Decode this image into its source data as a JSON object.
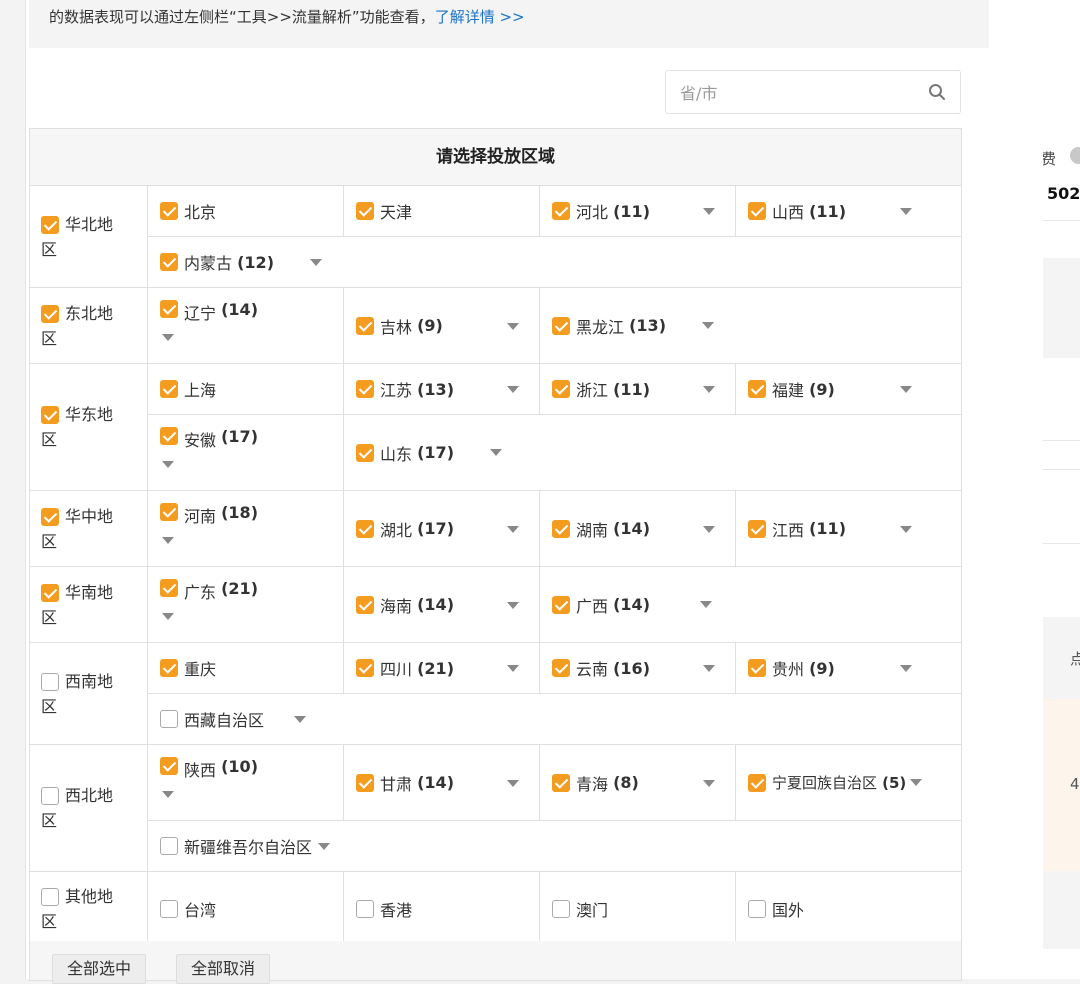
{
  "notice": {
    "text": "的数据表现可以通过左侧栏“工具>>流量解析”功能查看，",
    "link": "了解详情 >>"
  },
  "search": {
    "placeholder": "省/市",
    "value": ""
  },
  "table_title": "请选择投放区域",
  "regions": {
    "north": {
      "label": "华北地区",
      "checked": true
    },
    "northeast": {
      "label": "东北地区",
      "checked": true
    },
    "east": {
      "label": "华东地区",
      "checked": true
    },
    "central": {
      "label": "华中地区",
      "checked": true
    },
    "south": {
      "label": "华南地区",
      "checked": true
    },
    "southwest": {
      "label": "西南地区",
      "checked": false
    },
    "northwest": {
      "label": "西北地区",
      "checked": false
    },
    "other": {
      "label": "其他地区",
      "checked": false
    }
  },
  "provinces": {
    "beijing": {
      "name": "北京",
      "count": ""
    },
    "tianjin": {
      "name": "天津",
      "count": ""
    },
    "hebei": {
      "name": "河北",
      "count": "(11)"
    },
    "shanxi": {
      "name": "山西",
      "count": "(11)"
    },
    "neimenggu": {
      "name": "内蒙古",
      "count": "(12)"
    },
    "liaoning": {
      "name": "辽宁",
      "count": "(14)"
    },
    "jilin": {
      "name": "吉林",
      "count": "(9)"
    },
    "heilongjiang": {
      "name": "黑龙江",
      "count": "(13)"
    },
    "shanghai": {
      "name": "上海",
      "count": ""
    },
    "jiangsu": {
      "name": "江苏",
      "count": "(13)"
    },
    "zhejiang": {
      "name": "浙江",
      "count": "(11)"
    },
    "fujian": {
      "name": "福建",
      "count": "(9)"
    },
    "anhui": {
      "name": "安徽",
      "count": "(17)"
    },
    "shandong": {
      "name": "山东",
      "count": "(17)"
    },
    "henan": {
      "name": "河南",
      "count": "(18)"
    },
    "hubei": {
      "name": "湖北",
      "count": "(17)"
    },
    "hunan": {
      "name": "湖南",
      "count": "(14)"
    },
    "jiangxi": {
      "name": "江西",
      "count": "(11)"
    },
    "guangdong": {
      "name": "广东",
      "count": "(21)"
    },
    "hainan": {
      "name": "海南",
      "count": "(14)"
    },
    "guangxi": {
      "name": "广西",
      "count": "(14)"
    },
    "chongqing": {
      "name": "重庆",
      "count": ""
    },
    "sichuan": {
      "name": "四川",
      "count": "(21)"
    },
    "yunnan": {
      "name": "云南",
      "count": "(16)"
    },
    "guizhou": {
      "name": "贵州",
      "count": "(9)"
    },
    "xizang": {
      "name": "西藏自治区",
      "count": ""
    },
    "shaanxi": {
      "name": "陕西",
      "count": "(10)"
    },
    "gansu": {
      "name": "甘肃",
      "count": "(14)"
    },
    "qinghai": {
      "name": "青海",
      "count": "(8)"
    },
    "ningxia": {
      "name": "宁夏回族自治区",
      "count": "(5)"
    },
    "xinjiang": {
      "name": "新疆维吾尔自治区",
      "count": ""
    },
    "taiwan": {
      "name": "台湾",
      "count": ""
    },
    "xianggang": {
      "name": "香港",
      "count": ""
    },
    "aomen": {
      "name": "澳门",
      "count": ""
    },
    "guowai": {
      "name": "国外",
      "count": ""
    }
  },
  "buttons": {
    "select_all": "全部选中",
    "deselect_all": "全部取消"
  },
  "right_panel": {
    "fee_label": "费",
    "amount": "502",
    "label2": "点",
    "value2": "4"
  },
  "colors": {
    "accent": "#f39c1f",
    "link": "#1a73c8"
  }
}
